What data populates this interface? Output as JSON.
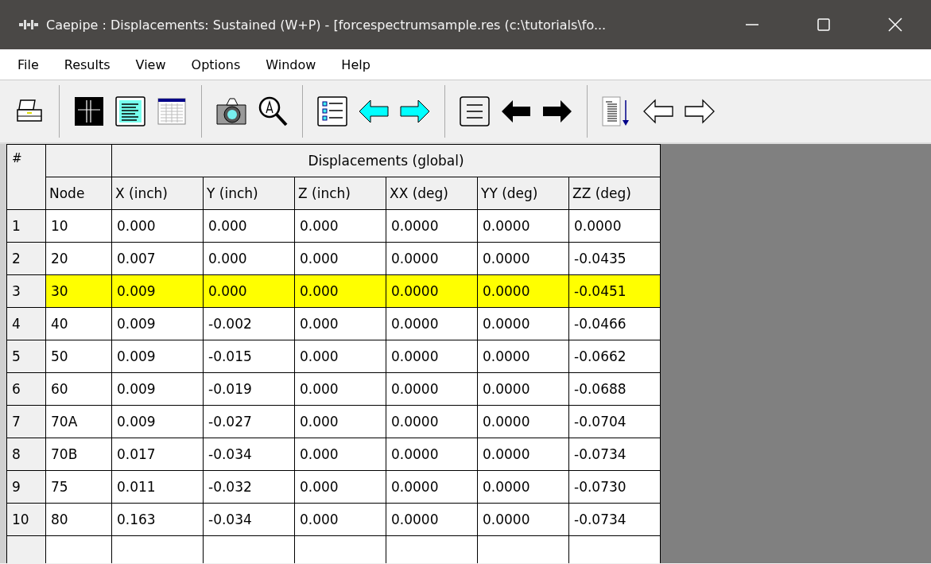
{
  "window": {
    "title": "Caepipe : Displacements: Sustained (W+P) -  [forcespectrumsample.res (c:\\tutorials\\fo..."
  },
  "menu": [
    "File",
    "Results",
    "View",
    "Options",
    "Window",
    "Help"
  ],
  "table": {
    "group_header": "Displacements (global)",
    "index_header": "#",
    "columns": [
      "Node",
      "X (inch)",
      "Y (inch)",
      "Z (inch)",
      "XX (deg)",
      "YY (deg)",
      "ZZ (deg)"
    ],
    "rows": [
      {
        "index": "1",
        "cells": [
          "10",
          "0.000",
          "0.000",
          "0.000",
          "0.0000",
          "0.0000",
          "0.0000"
        ],
        "selected": false
      },
      {
        "index": "2",
        "cells": [
          "20",
          "0.007",
          "0.000",
          "0.000",
          "0.0000",
          "0.0000",
          "-0.0435"
        ],
        "selected": false
      },
      {
        "index": "3",
        "cells": [
          "30",
          "0.009",
          "0.000",
          "0.000",
          "0.0000",
          "0.0000",
          "-0.0451"
        ],
        "selected": true
      },
      {
        "index": "4",
        "cells": [
          "40",
          "0.009",
          "-0.002",
          "0.000",
          "0.0000",
          "0.0000",
          "-0.0466"
        ],
        "selected": false
      },
      {
        "index": "5",
        "cells": [
          "50",
          "0.009",
          "-0.015",
          "0.000",
          "0.0000",
          "0.0000",
          "-0.0662"
        ],
        "selected": false
      },
      {
        "index": "6",
        "cells": [
          "60",
          "0.009",
          "-0.019",
          "0.000",
          "0.0000",
          "0.0000",
          "-0.0688"
        ],
        "selected": false
      },
      {
        "index": "7",
        "cells": [
          "70A",
          "0.009",
          "-0.027",
          "0.000",
          "0.0000",
          "0.0000",
          "-0.0704"
        ],
        "selected": false
      },
      {
        "index": "8",
        "cells": [
          "70B",
          "0.017",
          "-0.034",
          "0.000",
          "0.0000",
          "0.0000",
          "-0.0734"
        ],
        "selected": false
      },
      {
        "index": "9",
        "cells": [
          "75",
          "0.011",
          "-0.032",
          "0.000",
          "0.0000",
          "0.0000",
          "-0.0730"
        ],
        "selected": false
      },
      {
        "index": "10",
        "cells": [
          "80",
          "0.163",
          "-0.034",
          "0.000",
          "0.0000",
          "0.0000",
          "-0.0734"
        ],
        "selected": false
      }
    ]
  }
}
